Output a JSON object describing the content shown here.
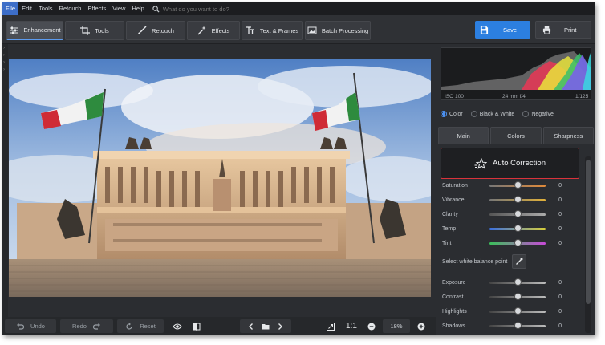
{
  "menu": [
    "File",
    "Edit",
    "Tools",
    "Retouch",
    "Effects",
    "View",
    "Help"
  ],
  "search": {
    "placeholder": "What do you want to do?"
  },
  "tabs": [
    {
      "label": "Enhancement"
    },
    {
      "label": "Tools"
    },
    {
      "label": "Retouch"
    },
    {
      "label": "Effects"
    },
    {
      "label": "Text & Frames"
    },
    {
      "label": "Batch Processing"
    }
  ],
  "actions": {
    "save": "Save",
    "print": "Print"
  },
  "exif": {
    "iso": "ISO 100",
    "lens": "24 mm f/4",
    "shutter": "1/125"
  },
  "color_modes": {
    "color": "Color",
    "bw": "Black & White",
    "negative": "Negative",
    "selected": "Color"
  },
  "subtabs": [
    {
      "label": "Main"
    },
    {
      "label": "Colors"
    },
    {
      "label": "Sharpness"
    }
  ],
  "auto_correction": "Auto Correction",
  "sliders_top": [
    {
      "label": "Saturation",
      "value": "0"
    },
    {
      "label": "Vibrance",
      "value": "0"
    },
    {
      "label": "Clarity",
      "value": "0"
    },
    {
      "label": "Temp",
      "value": "0"
    },
    {
      "label": "Tint",
      "value": "0"
    }
  ],
  "white_balance": "Select white balance point",
  "sliders_bottom": [
    {
      "label": "Exposure",
      "value": "0"
    },
    {
      "label": "Contrast",
      "value": "0"
    },
    {
      "label": "Highlights",
      "value": "0"
    },
    {
      "label": "Shadows",
      "value": "0"
    }
  ],
  "bottom": {
    "undo": "Undo",
    "redo": "Redo",
    "reset": "Reset",
    "ratio": "1:1",
    "zoom": "18%"
  },
  "colors": {
    "accent": "#2c7fe0",
    "highlight_border": "#d9333b",
    "menu_active": "#3d6ec8"
  }
}
